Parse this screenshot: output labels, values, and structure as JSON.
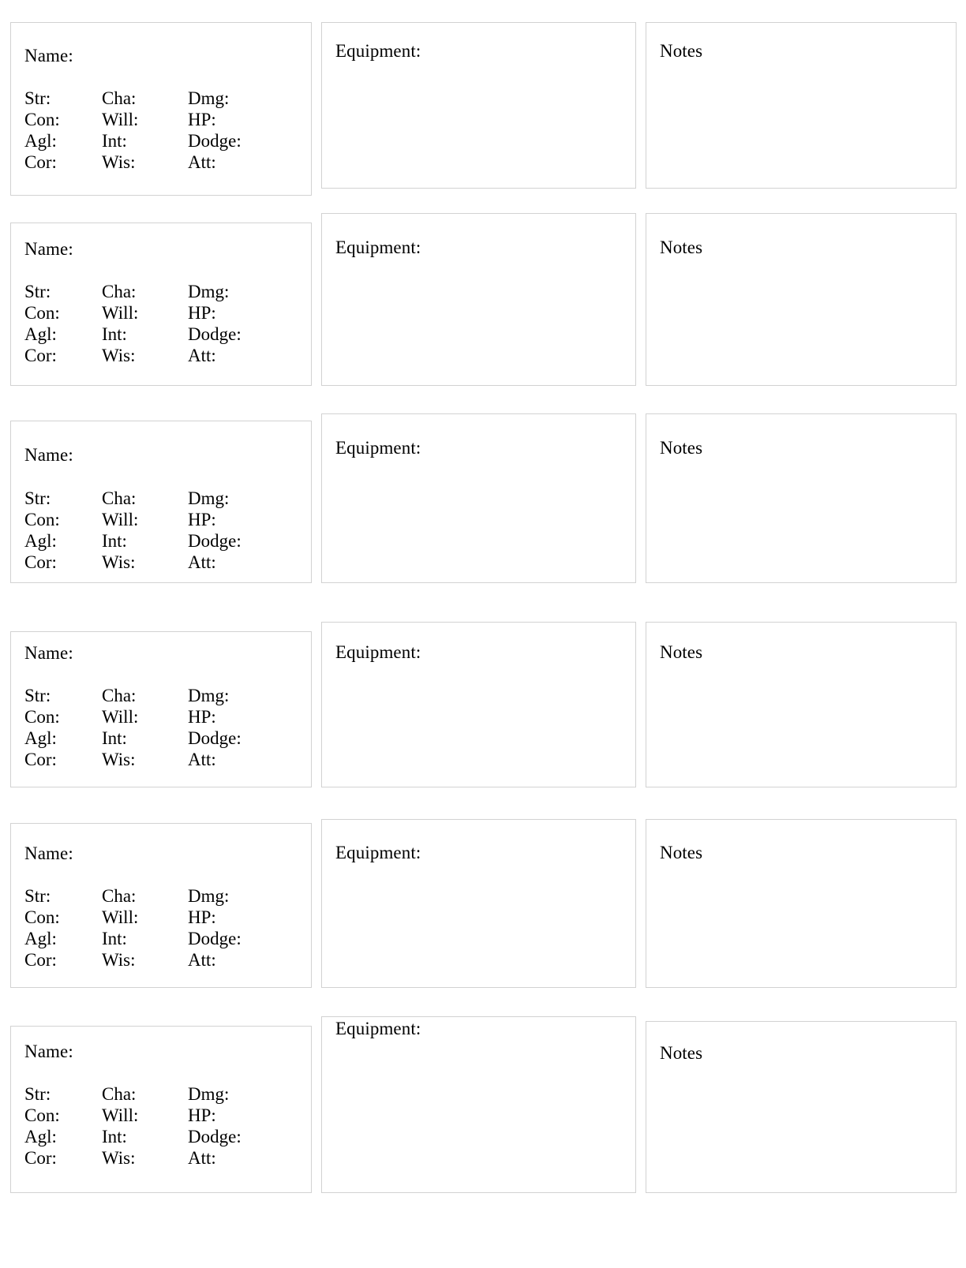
{
  "page": {
    "background_color": "#ffffff",
    "text_color": "#000000",
    "border_color": "#d2d2d2",
    "entry_count": 6
  },
  "labels": {
    "name": "Name:",
    "equipment": "Equipment:",
    "notes": "Notes"
  },
  "stat_rows": [
    {
      "col1": "Str:",
      "col2": "Cha:",
      "col3": "Dmg:"
    },
    {
      "col1": "Con:",
      "col2": "Will:",
      "col3": "HP:"
    },
    {
      "col1": "Agl:",
      "col2": "Int:",
      "col3": "Dodge:"
    },
    {
      "col1": "Cor:",
      "col2": "Wis:",
      "col3": "Att:"
    }
  ],
  "entries": [
    {
      "index": 1,
      "name_value": "",
      "equipment_value": "",
      "notes_value": "",
      "stats": {
        "Str": "",
        "Cha": "",
        "Dmg": "",
        "Con": "",
        "Will": "",
        "HP": "",
        "Agl": "",
        "Int": "",
        "Dodge": "",
        "Cor": "",
        "Wis": "",
        "Att": ""
      }
    },
    {
      "index": 2,
      "name_value": "",
      "equipment_value": "",
      "notes_value": "",
      "stats": {
        "Str": "",
        "Cha": "",
        "Dmg": "",
        "Con": "",
        "Will": "",
        "HP": "",
        "Agl": "",
        "Int": "",
        "Dodge": "",
        "Cor": "",
        "Wis": "",
        "Att": ""
      }
    },
    {
      "index": 3,
      "name_value": "",
      "equipment_value": "",
      "notes_value": "",
      "stats": {
        "Str": "",
        "Cha": "",
        "Dmg": "",
        "Con": "",
        "Will": "",
        "HP": "",
        "Agl": "",
        "Int": "",
        "Dodge": "",
        "Cor": "",
        "Wis": "",
        "Att": ""
      }
    },
    {
      "index": 4,
      "name_value": "",
      "equipment_value": "",
      "notes_value": "",
      "stats": {
        "Str": "",
        "Cha": "",
        "Dmg": "",
        "Con": "",
        "Will": "",
        "HP": "",
        "Agl": "",
        "Int": "",
        "Dodge": "",
        "Cor": "",
        "Wis": "",
        "Att": ""
      }
    },
    {
      "index": 5,
      "name_value": "",
      "equipment_value": "",
      "notes_value": "",
      "stats": {
        "Str": "",
        "Cha": "",
        "Dmg": "",
        "Con": "",
        "Will": "",
        "HP": "",
        "Agl": "",
        "Int": "",
        "Dodge": "",
        "Cor": "",
        "Wis": "",
        "Att": ""
      }
    },
    {
      "index": 6,
      "name_value": "",
      "equipment_value": "",
      "notes_value": "",
      "stats": {
        "Str": "",
        "Cha": "",
        "Dmg": "",
        "Con": "",
        "Will": "",
        "HP": "",
        "Agl": "",
        "Int": "",
        "Dodge": "",
        "Cor": "",
        "Wis": "",
        "Att": ""
      }
    }
  ]
}
